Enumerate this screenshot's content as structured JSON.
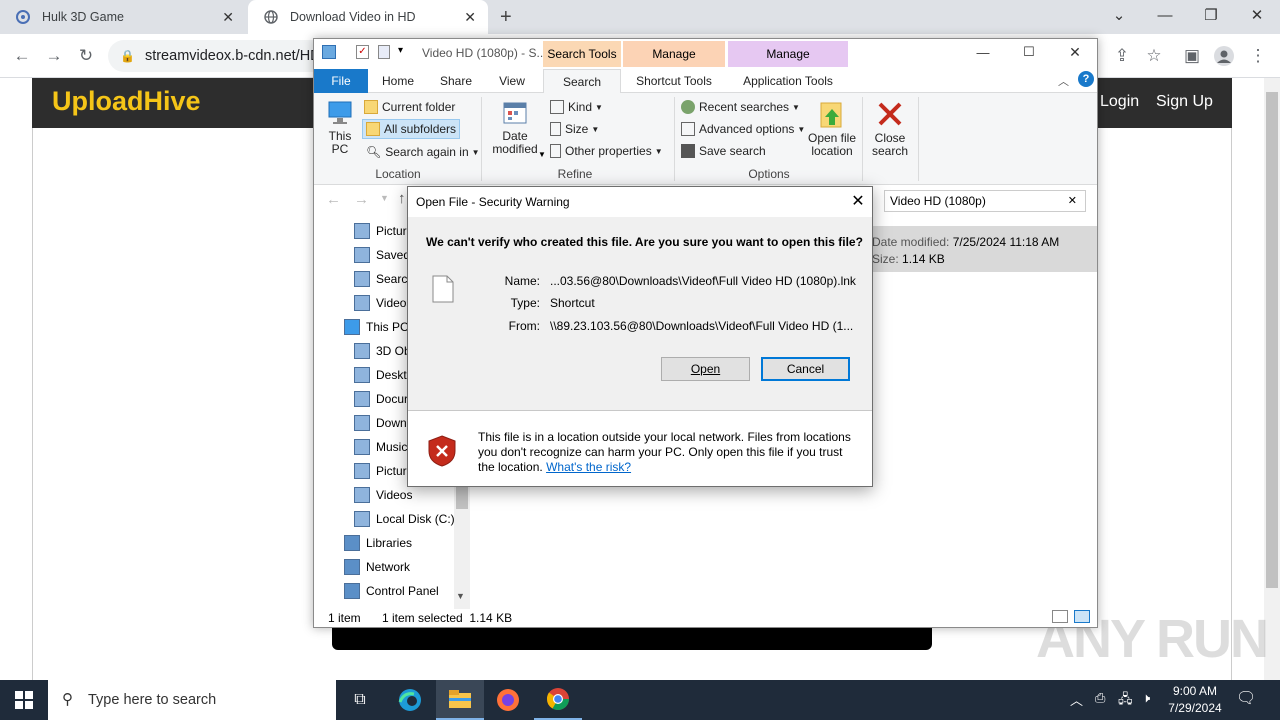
{
  "browser": {
    "tabs": [
      {
        "title": "Hulk 3D Game"
      },
      {
        "title": "Download Video in HD"
      }
    ],
    "url": "streamvideox.b-cdn.net/HD-"
  },
  "site": {
    "logo": "UploadHive",
    "login": "Login",
    "signup": "Sign Up",
    "watermark": "ANY RUN"
  },
  "explorer": {
    "window_title": "Video HD (1080p) - S...",
    "context_headers": [
      "Search Tools",
      "Manage",
      "Manage"
    ],
    "tabs": [
      "File",
      "Home",
      "Share",
      "View",
      "Search",
      "Shortcut Tools",
      "Application Tools"
    ],
    "ribbon": {
      "this_pc": "This\nPC",
      "current_folder": "Current folder",
      "all_subfolders": "All subfolders",
      "search_again": "Search again in",
      "location_label": "Location",
      "date_modified": "Date\nmodified",
      "kind": "Kind",
      "size": "Size",
      "other_properties": "Other properties",
      "refine_label": "Refine",
      "recent_searches": "Recent searches",
      "advanced_options": "Advanced options",
      "save_search": "Save search",
      "open_file_location": "Open file\nlocation",
      "close_search": "Close\nsearch",
      "options_label": "Options"
    },
    "search_value": "Video HD (1080p)",
    "details": {
      "date_modified_label": "Date modified:",
      "date_modified": "7/25/2024 11:18 AM",
      "size_label": "Size:",
      "size": "1.14 KB"
    },
    "nav": [
      {
        "label": "Pictur",
        "icon": "pictures-icon"
      },
      {
        "label": "Saved",
        "icon": "saved-icon"
      },
      {
        "label": "Search",
        "icon": "search-icon"
      },
      {
        "label": "Videos",
        "icon": "videos-icon"
      },
      {
        "label": "This PC",
        "icon": "pc-icon"
      },
      {
        "label": "3D Ob",
        "icon": "3d-objects-icon"
      },
      {
        "label": "Deskto",
        "icon": "desktop-icon"
      },
      {
        "label": "Docur",
        "icon": "documents-icon"
      },
      {
        "label": "Downl",
        "icon": "downloads-icon"
      },
      {
        "label": "Music",
        "icon": "music-icon"
      },
      {
        "label": "Pictur",
        "icon": "pictures-icon"
      },
      {
        "label": "Videos",
        "icon": "videos-icon"
      },
      {
        "label": "Local Disk (C:)",
        "icon": "disk-icon"
      },
      {
        "label": "Libraries",
        "icon": "libraries-icon"
      },
      {
        "label": "Network",
        "icon": "network-icon"
      },
      {
        "label": "Control Panel",
        "icon": "control-panel-icon"
      }
    ],
    "status_items": "1 item",
    "status_selected": "1 item selected  1.14 KB"
  },
  "dialog": {
    "title": "Open File - Security Warning",
    "question": "We can't verify who created this file. Are you sure you want to open this file?",
    "name_label": "Name:",
    "name_value": "...03.56@80\\Downloads\\Videof\\Full Video HD (1080p).lnk",
    "type_label": "Type:",
    "type_value": "Shortcut",
    "from_label": "From:",
    "from_value": "\\\\89.23.103.56@80\\Downloads\\Videof\\Full Video HD (1...",
    "open_button": "Open",
    "cancel_button": "Cancel",
    "warning_text": "This file is in a location outside your local network. Files from locations you don't recognize can harm your PC. Only open this file if you trust the location.",
    "risk_link": "What's the risk?"
  },
  "taskbar": {
    "search_placeholder": "Type here to search",
    "time": "9:00 AM",
    "date": "7/29/2024"
  },
  "colors": {
    "accent_blue": "#1979ca",
    "logo_yellow": "#f5c518",
    "search_tools_ctx": "#fbd8b4",
    "manage_orange": "#fcd3b5",
    "manage_purple": "#e6c8f2"
  }
}
